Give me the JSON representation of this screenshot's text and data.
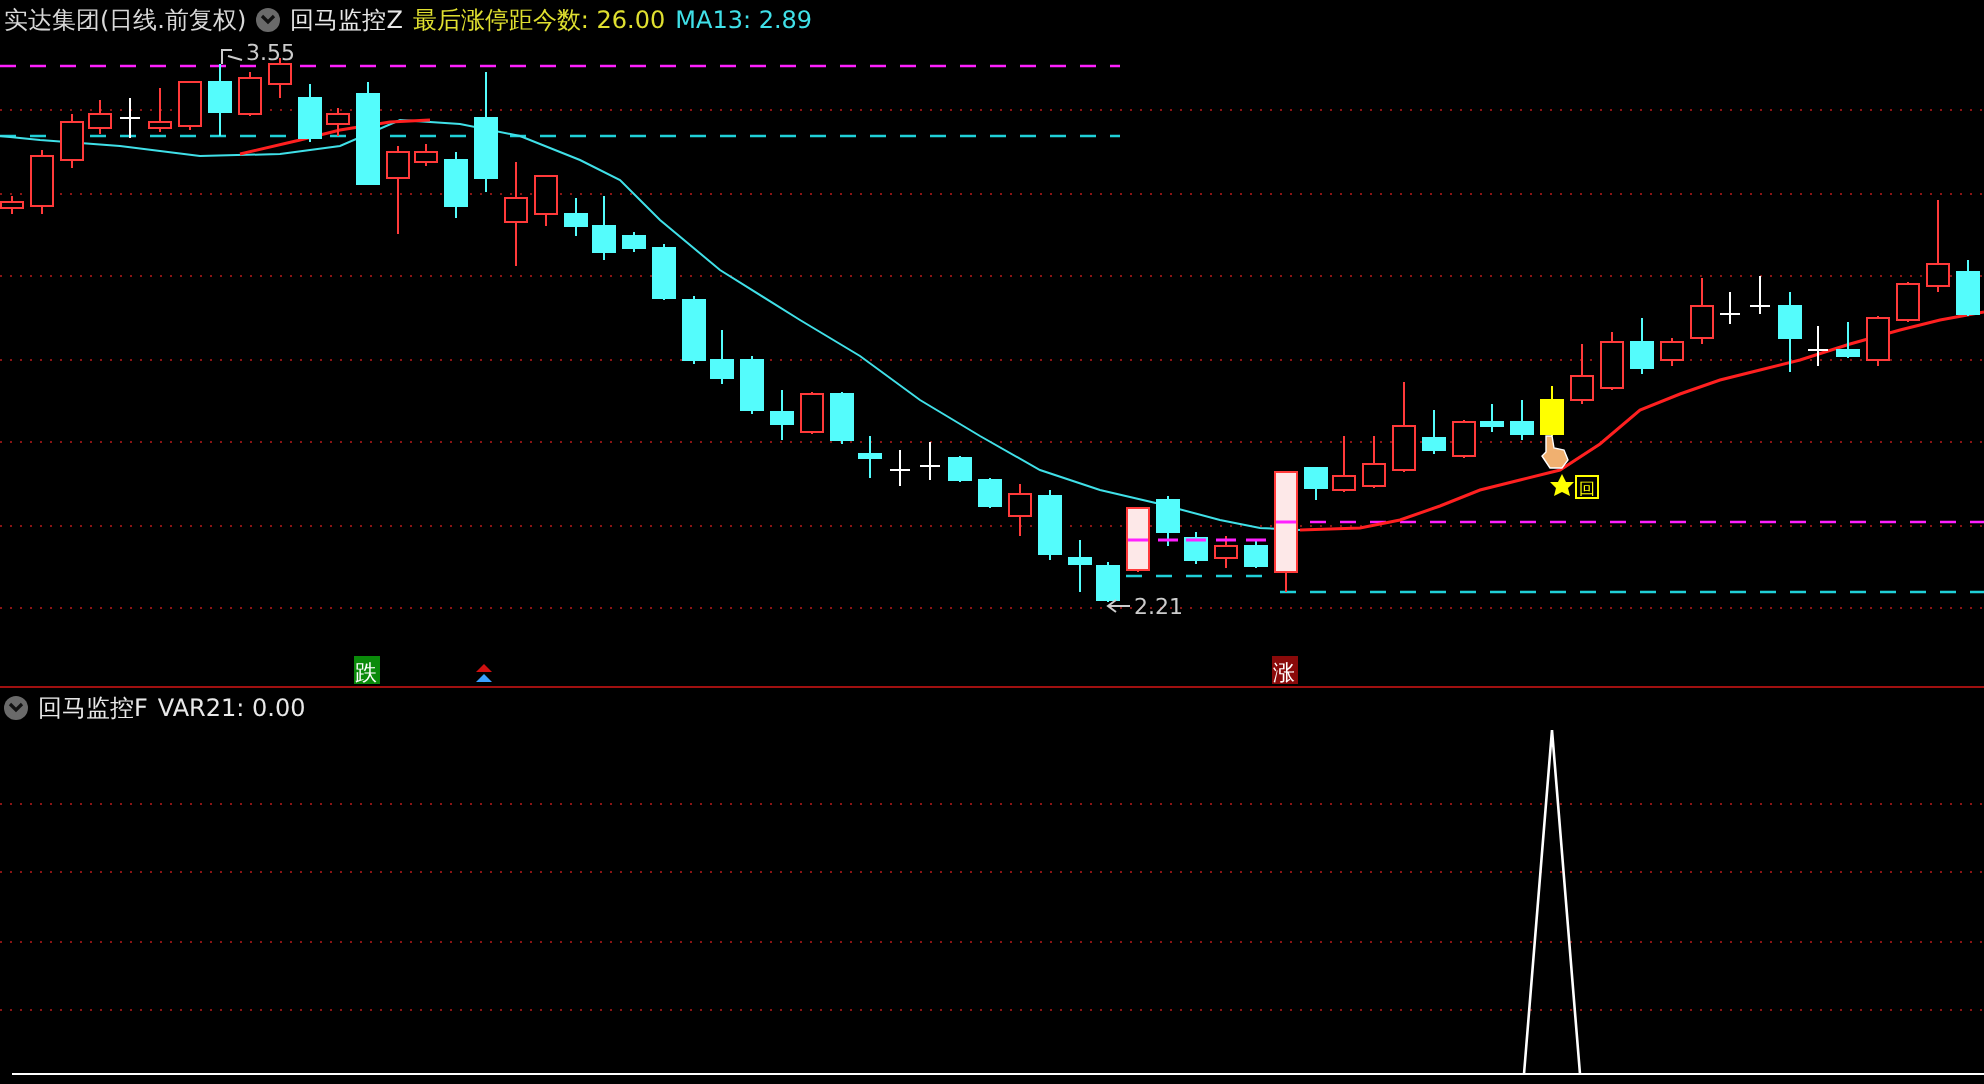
{
  "main_panel": {
    "title": "实达集团(日线.前复权)",
    "indicator": "回马监控Z",
    "values": [
      {
        "label": "最后涨停距今数: 26.00",
        "color": "#e0e030"
      },
      {
        "label": "MA13: 2.89",
        "color": "#40e0e8"
      }
    ],
    "high_label": "3.55",
    "low_label": "2.21",
    "signal_mark": "回",
    "signals": [
      {
        "kind": "fall",
        "text": "跌"
      },
      {
        "kind": "arrow"
      },
      {
        "kind": "rise",
        "text": "涨"
      }
    ]
  },
  "lower_panel": {
    "indicator": "回马监控F",
    "values": [
      {
        "label": "VAR21: 0.00",
        "color": "#e8e8e8"
      }
    ]
  }
}
